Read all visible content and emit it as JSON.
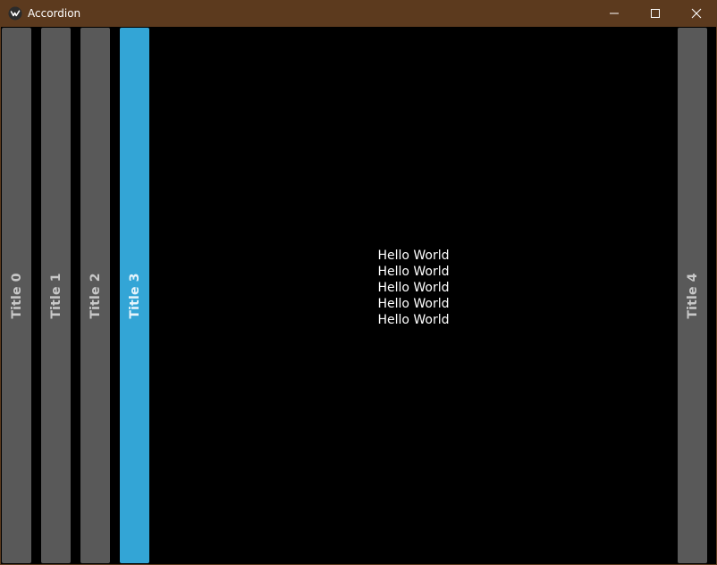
{
  "window": {
    "title": "Accordion",
    "titlebar_color": "#5c3a1e",
    "icon": "kivy-app-icon",
    "controls": {
      "minimize_icon": "minimize-icon",
      "maximize_icon": "maximize-icon",
      "close_icon": "close-icon"
    }
  },
  "accordion": {
    "items": [
      {
        "label": "Title 0",
        "selected": false
      },
      {
        "label": "Title 1",
        "selected": false
      },
      {
        "label": "Title 2",
        "selected": false
      },
      {
        "label": "Title 3",
        "selected": true
      },
      {
        "label": "Title 4",
        "selected": false
      }
    ],
    "colors": {
      "title_bg": "#595959",
      "selected_bg": "#33a5d6",
      "content_bg": "#000000"
    },
    "content": {
      "lines": [
        "Hello World",
        "Hello World",
        "Hello World",
        "Hello World",
        "Hello World"
      ]
    }
  }
}
